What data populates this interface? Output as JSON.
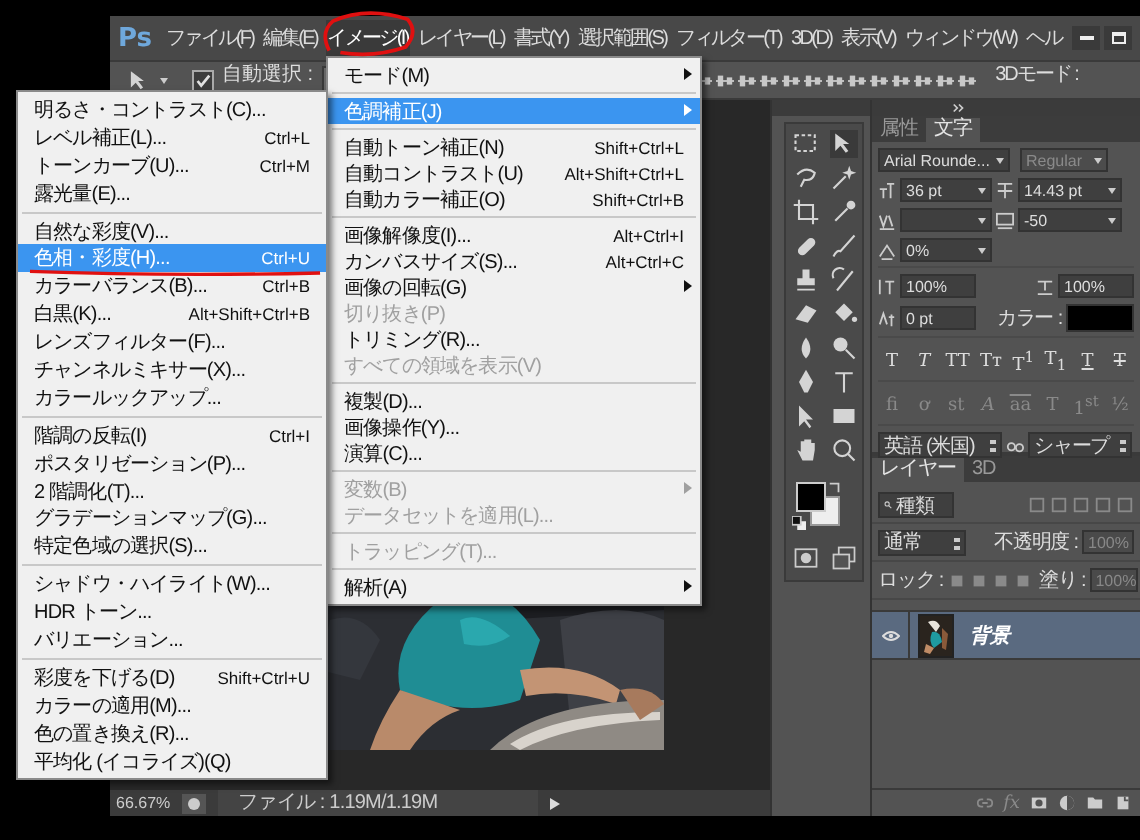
{
  "app": {
    "logo": "Ps"
  },
  "menubar": [
    {
      "label": "ファイル(F)",
      "selected": false
    },
    {
      "label": "編集(E)",
      "selected": false
    },
    {
      "label": "イメージ(I)",
      "selected": true
    },
    {
      "label": "レイヤー(L)",
      "selected": false
    },
    {
      "label": "書式(Y)",
      "selected": false
    },
    {
      "label": "選択範囲(S)",
      "selected": false
    },
    {
      "label": "フィルター(T)",
      "selected": false
    },
    {
      "label": "3D(D)",
      "selected": false
    },
    {
      "label": "表示(V)",
      "selected": false
    },
    {
      "label": "ウィンドウ(W)",
      "selected": false
    },
    {
      "label": "ヘル",
      "selected": false
    }
  ],
  "options_bar": {
    "auto_select": {
      "label": "自動選択 :",
      "checked": true
    },
    "mode_label": "3Dモード :"
  },
  "image_menu": [
    {
      "kind": "item",
      "label": "モード(M)",
      "submenu": true,
      "disabled": false,
      "selected": false
    },
    {
      "kind": "separator"
    },
    {
      "kind": "item",
      "label": "色調補正(J)",
      "submenu": true,
      "disabled": false,
      "selected": true
    },
    {
      "kind": "separator"
    },
    {
      "kind": "item",
      "label": "自動トーン補正(N)",
      "shortcut": "Shift+Ctrl+L",
      "submenu": false,
      "disabled": false,
      "selected": false
    },
    {
      "kind": "item",
      "label": "自動コントラスト(U)",
      "shortcut": "Alt+Shift+Ctrl+L",
      "submenu": false,
      "disabled": false,
      "selected": false
    },
    {
      "kind": "item",
      "label": "自動カラー補正(O)",
      "shortcut": "Shift+Ctrl+B",
      "submenu": false,
      "disabled": false,
      "selected": false
    },
    {
      "kind": "separator"
    },
    {
      "kind": "item",
      "label": "画像解像度(I)...",
      "shortcut": "Alt+Ctrl+I",
      "submenu": false,
      "disabled": false,
      "selected": false
    },
    {
      "kind": "item",
      "label": "カンバスサイズ(S)...",
      "shortcut": "Alt+Ctrl+C",
      "submenu": false,
      "disabled": false,
      "selected": false
    },
    {
      "kind": "item",
      "label": "画像の回転(G)",
      "submenu": true,
      "disabled": false,
      "selected": false
    },
    {
      "kind": "item",
      "label": "切り抜き(P)",
      "submenu": false,
      "disabled": true,
      "selected": false
    },
    {
      "kind": "item",
      "label": "トリミング(R)...",
      "submenu": false,
      "disabled": false,
      "selected": false
    },
    {
      "kind": "item",
      "label": "すべての領域を表示(V)",
      "submenu": false,
      "disabled": true,
      "selected": false
    },
    {
      "kind": "separator"
    },
    {
      "kind": "item",
      "label": "複製(D)...",
      "submenu": false,
      "disabled": false,
      "selected": false
    },
    {
      "kind": "item",
      "label": "画像操作(Y)...",
      "submenu": false,
      "disabled": false,
      "selected": false
    },
    {
      "kind": "item",
      "label": "演算(C)...",
      "submenu": false,
      "disabled": false,
      "selected": false
    },
    {
      "kind": "separator"
    },
    {
      "kind": "item",
      "label": "変数(B)",
      "submenu": true,
      "disabled": true,
      "selected": false
    },
    {
      "kind": "item",
      "label": "データセットを適用(L)...",
      "submenu": false,
      "disabled": true,
      "selected": false
    },
    {
      "kind": "separator"
    },
    {
      "kind": "item",
      "label": "トラッピング(T)...",
      "submenu": false,
      "disabled": true,
      "selected": false
    },
    {
      "kind": "separator"
    },
    {
      "kind": "item",
      "label": "解析(A)",
      "submenu": true,
      "disabled": false,
      "selected": false
    }
  ],
  "adjustments_menu": [
    {
      "kind": "item",
      "label": "明るさ・コントラスト(C)...",
      "selected": false
    },
    {
      "kind": "item",
      "label": "レベル補正(L)...",
      "shortcut": "Ctrl+L",
      "selected": false
    },
    {
      "kind": "item",
      "label": "トーンカーブ(U)...",
      "shortcut": "Ctrl+M",
      "selected": false
    },
    {
      "kind": "item",
      "label": "露光量(E)...",
      "selected": false
    },
    {
      "kind": "separator"
    },
    {
      "kind": "item",
      "label": "自然な彩度(V)...",
      "selected": false
    },
    {
      "kind": "item",
      "label": "色相・彩度(H)...",
      "shortcut": "Ctrl+U",
      "selected": true
    },
    {
      "kind": "item",
      "label": "カラーバランス(B)...",
      "shortcut": "Ctrl+B",
      "selected": false
    },
    {
      "kind": "item",
      "label": "白黒(K)...",
      "shortcut": "Alt+Shift+Ctrl+B",
      "selected": false
    },
    {
      "kind": "item",
      "label": "レンズフィルター(F)...",
      "selected": false
    },
    {
      "kind": "item",
      "label": "チャンネルミキサー(X)...",
      "selected": false
    },
    {
      "kind": "item",
      "label": "カラールックアップ...",
      "selected": false
    },
    {
      "kind": "separator"
    },
    {
      "kind": "item",
      "label": "階調の反転(I)",
      "shortcut": "Ctrl+I",
      "selected": false
    },
    {
      "kind": "item",
      "label": "ポスタリゼーション(P)...",
      "selected": false
    },
    {
      "kind": "item",
      "label": "2 階調化(T)...",
      "selected": false
    },
    {
      "kind": "item",
      "label": "グラデーションマップ(G)...",
      "selected": false
    },
    {
      "kind": "item",
      "label": "特定色域の選択(S)...",
      "selected": false
    },
    {
      "kind": "separator"
    },
    {
      "kind": "item",
      "label": "シャドウ・ハイライト(W)...",
      "selected": false
    },
    {
      "kind": "item",
      "label": "HDR トーン...",
      "selected": false
    },
    {
      "kind": "item",
      "label": "バリエーション...",
      "selected": false
    },
    {
      "kind": "separator"
    },
    {
      "kind": "item",
      "label": "彩度を下げる(D)",
      "shortcut": "Shift+Ctrl+U",
      "selected": false
    },
    {
      "kind": "item",
      "label": "カラーの適用(M)...",
      "selected": false
    },
    {
      "kind": "item",
      "label": "色の置き換え(R)...",
      "selected": false
    },
    {
      "kind": "item",
      "label": "平均化 (イコライズ)(Q)",
      "selected": false
    }
  ],
  "status_bar": {
    "zoom": "66.67%",
    "file_info": "ファイル : 1.19M/1.19M"
  },
  "character_panel": {
    "tabs": [
      {
        "label": "属性",
        "selected": false
      },
      {
        "label": "文字",
        "selected": true
      }
    ],
    "font_family": "Arial Rounde...",
    "font_style": "Regular",
    "font_size": "36 pt",
    "leading": "14.43 pt",
    "tracking": "-50",
    "tsume": "0%",
    "vertical_scale": "100%",
    "horizontal_scale": "100%",
    "baseline_shift": "0 pt",
    "color_label": "カラー :",
    "style_buttons": [
      "T",
      "T",
      "TT",
      "Tᴛ",
      "T$^{1}$",
      "T$_{1}$",
      "T",
      "T"
    ],
    "opentype_buttons": [
      "fi",
      "ơ",
      "st",
      "A",
      "aa",
      "T",
      "1$^{st}$",
      "½"
    ],
    "language": "英語 (米国)",
    "antialias": "シャープ"
  },
  "layers_panel": {
    "tabs": [
      {
        "label": "レイヤー",
        "selected": true
      },
      {
        "label": "3D",
        "selected": false
      }
    ],
    "filter": "種類",
    "blend_mode": "通常",
    "opacity_label": "不透明度 :",
    "opacity": "100%",
    "lock_label": "ロック :",
    "fill_label": "塗り :",
    "fill": "100%",
    "layers": [
      {
        "name": "背景",
        "visible": true,
        "selected": true
      }
    ],
    "effects_button": "fx"
  }
}
